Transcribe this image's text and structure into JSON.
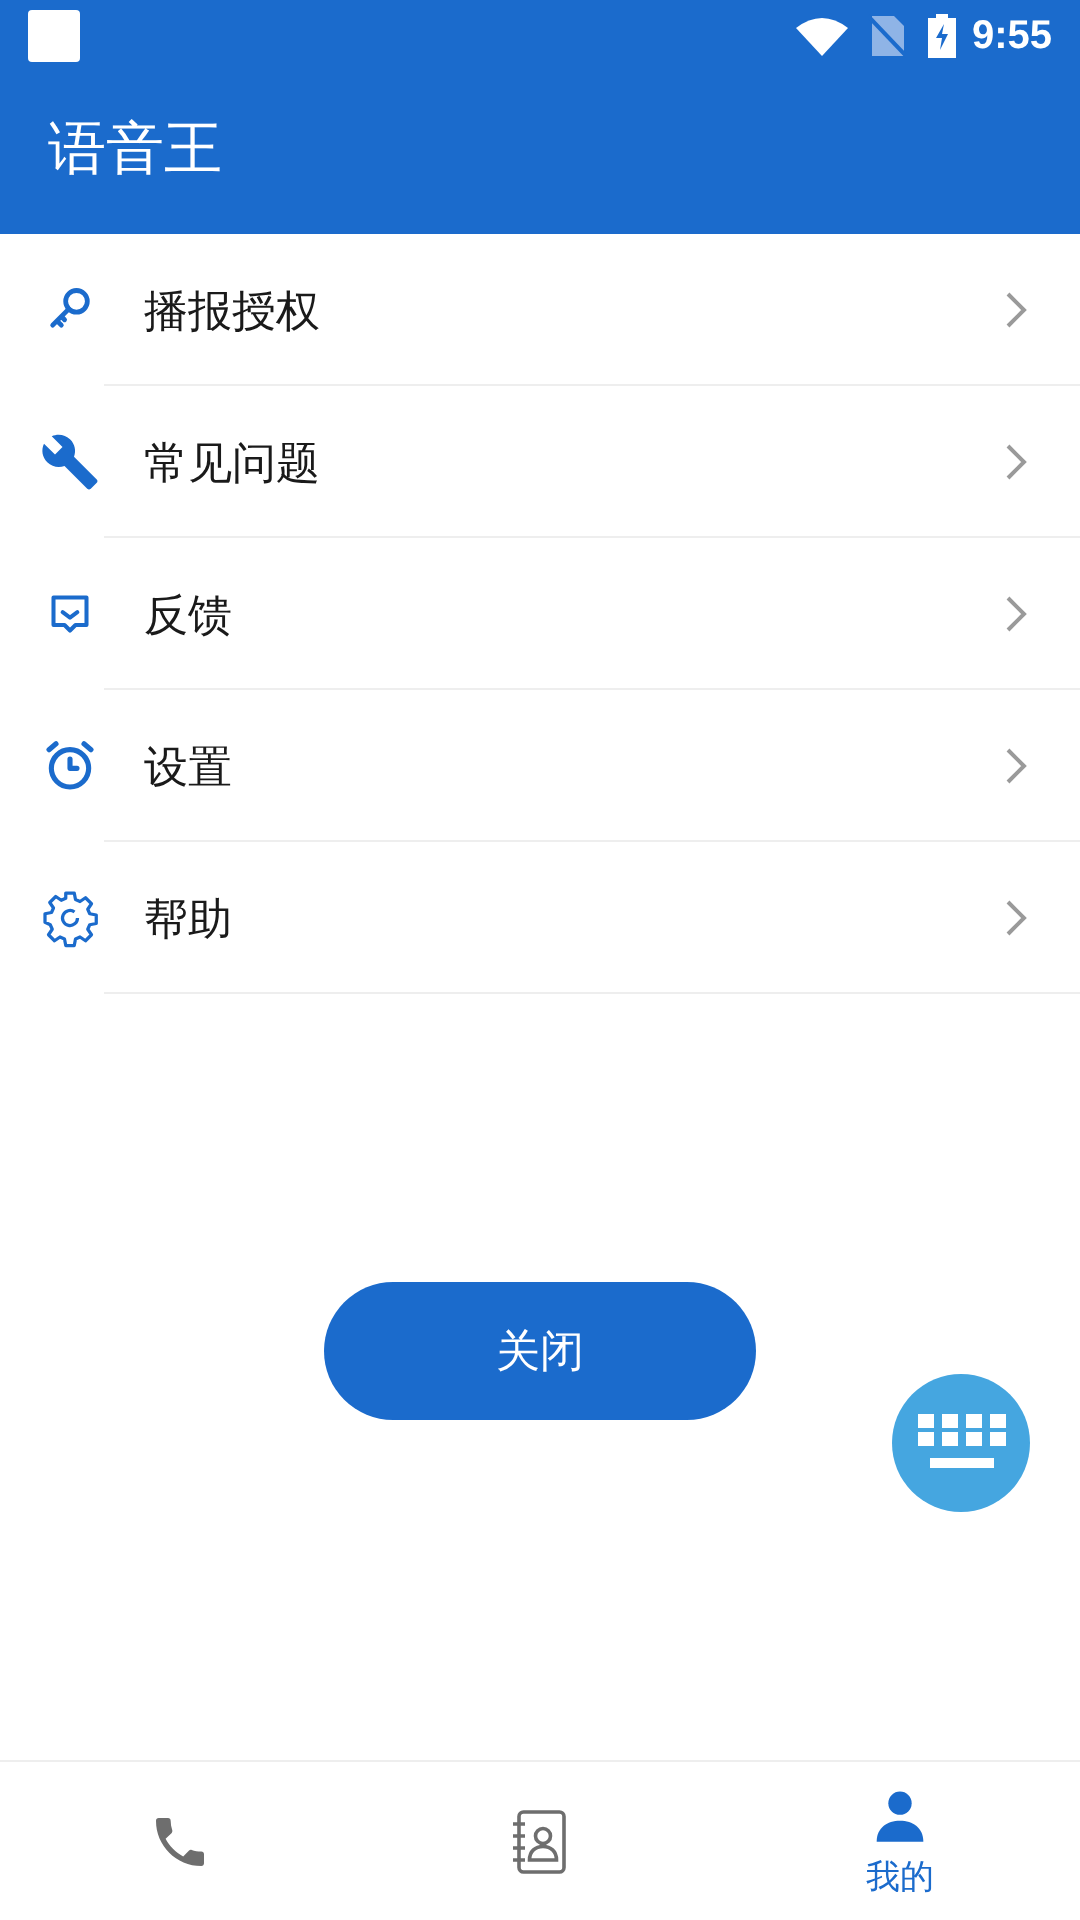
{
  "status_bar": {
    "time": "9:55"
  },
  "app_bar": {
    "title": "语音王"
  },
  "menu": [
    {
      "kind": "key",
      "label": "播报授权"
    },
    {
      "kind": "wrench",
      "label": "常见问题"
    },
    {
      "kind": "message",
      "label": "反馈"
    },
    {
      "kind": "alarm",
      "label": "设置"
    },
    {
      "kind": "gear",
      "label": "帮助"
    }
  ],
  "close_button": {
    "label": "关闭"
  },
  "bottom_nav": [
    {
      "kind": "phone",
      "selected": false
    },
    {
      "kind": "contacts",
      "selected": false
    },
    {
      "kind": "profile",
      "selected": true,
      "label": "我的"
    }
  ]
}
